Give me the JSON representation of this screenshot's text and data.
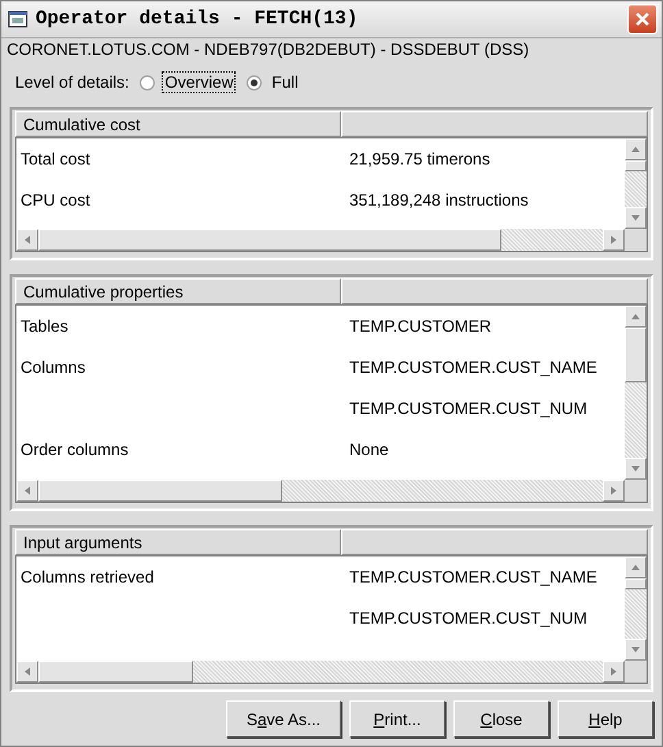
{
  "window": {
    "title": "Operator details - FETCH(13)"
  },
  "connection": "CORONET.LOTUS.COM - NDEB797(DB2DEBUT) - DSSDEBUT (DSS)",
  "level_of_details": {
    "label": "Level of details:",
    "options": [
      {
        "label": "Overview",
        "selected": false,
        "focused": true
      },
      {
        "label": "Full",
        "selected": true,
        "focused": false
      }
    ]
  },
  "sections": [
    {
      "title": "Cumulative cost",
      "rows": [
        {
          "name": "Total cost",
          "value": "21,959.75 timerons"
        },
        {
          "name": "CPU cost",
          "value": "351,189,248 instructions"
        }
      ]
    },
    {
      "title": "Cumulative properties",
      "rows": [
        {
          "name": "Tables",
          "value": "TEMP.CUSTOMER"
        },
        {
          "name": "Columns",
          "value": "TEMP.CUSTOMER.CUST_NAME"
        },
        {
          "value": "TEMP.CUSTOMER.CUST_NUM"
        },
        {
          "name": "Order columns",
          "value": "None"
        }
      ]
    },
    {
      "title": "Input arguments",
      "rows": [
        {
          "name": "Columns retrieved",
          "value": "TEMP.CUSTOMER.CUST_NAME"
        },
        {
          "value": "TEMP.CUSTOMER.CUST_NUM"
        }
      ]
    }
  ],
  "buttons": [
    {
      "label": "Save As..."
    },
    {
      "label": "Print..."
    },
    {
      "label": "Close"
    },
    {
      "label": "Help"
    }
  ]
}
